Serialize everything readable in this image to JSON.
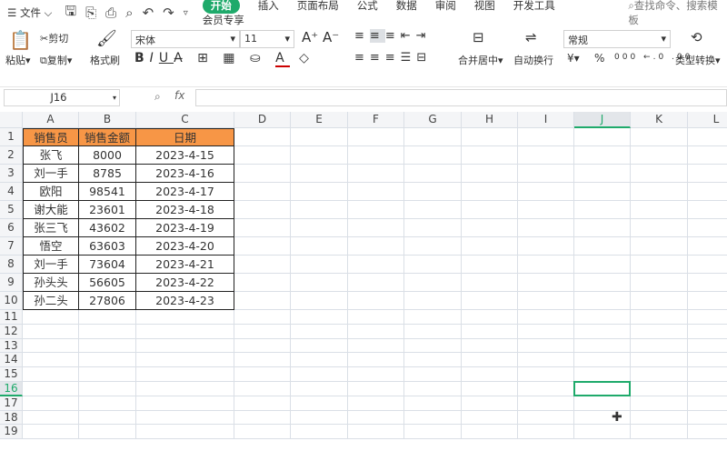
{
  "menubar": {
    "file": "文件",
    "tabs": [
      "开始",
      "插入",
      "页面布局",
      "公式",
      "数据",
      "审阅",
      "视图",
      "开发工具",
      "会员专享"
    ],
    "search": "查找命令、搜索模板"
  },
  "ribbon": {
    "paste": "粘贴",
    "cut": "剪切",
    "copy": "复制",
    "format_painter": "格式刷",
    "font": "宋体",
    "font_size": "11",
    "merge": "合并居中",
    "wrap": "自动换行",
    "number_format": "常规",
    "convert": "类型转换",
    "currency": "¥",
    "percent": "%"
  },
  "formula_bar": {
    "name_box": "J16",
    "fx": "fx",
    "value": ""
  },
  "sheet": {
    "columns": [
      "A",
      "B",
      "C",
      "D",
      "E",
      "F",
      "G",
      "H",
      "I",
      "J",
      "K",
      "L"
    ],
    "active_col": "J",
    "active_row": 16,
    "header_color": "#f79646",
    "accent": "#1faa6b",
    "table_headers": [
      "销售员",
      "销售金额",
      "日期"
    ],
    "rows": [
      [
        "张飞",
        "8000",
        "2023-4-15"
      ],
      [
        "刘一手",
        "8785",
        "2023-4-16"
      ],
      [
        "欧阳",
        "98541",
        "2023-4-17"
      ],
      [
        "谢大能",
        "23601",
        "2023-4-18"
      ],
      [
        "张三飞",
        "43602",
        "2023-4-19"
      ],
      [
        "悟空",
        "63603",
        "2023-4-20"
      ],
      [
        "刘一手",
        "73604",
        "2023-4-21"
      ],
      [
        "孙头头",
        "56605",
        "2023-4-22"
      ],
      [
        "孙二头",
        "27806",
        "2023-4-23"
      ]
    ]
  }
}
